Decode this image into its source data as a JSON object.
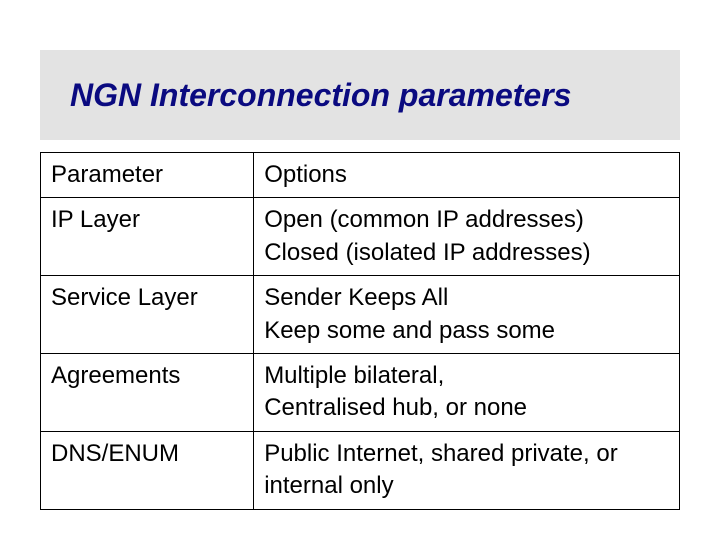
{
  "title": "NGN Interconnection parameters",
  "chart_data": {
    "type": "table",
    "title": "NGN Interconnection parameters",
    "columns": [
      "Parameter",
      "Options"
    ],
    "rows": [
      [
        "IP Layer",
        "Open (common IP addresses)\nClosed  (isolated IP addresses)"
      ],
      [
        "Service Layer",
        "Sender Keeps All\nKeep some and pass some"
      ],
      [
        "Agreements",
        "Multiple bilateral,\nCentralised hub,     or none"
      ],
      [
        "DNS/ENUM",
        "Public Internet, shared private, or internal only"
      ]
    ]
  },
  "header": {
    "param": "Parameter",
    "opts": "Options"
  },
  "rows": [
    {
      "param": "IP Layer",
      "opts": "Open (common IP addresses)\nClosed  (isolated IP addresses)"
    },
    {
      "param": "Service Layer",
      "opts": "Sender Keeps All\nKeep some and pass some"
    },
    {
      "param": "Agreements",
      "opts": "Multiple bilateral,\nCentralised hub,     or none"
    },
    {
      "param": "DNS/ENUM",
      "opts": "Public Internet, shared private, or internal only"
    }
  ]
}
